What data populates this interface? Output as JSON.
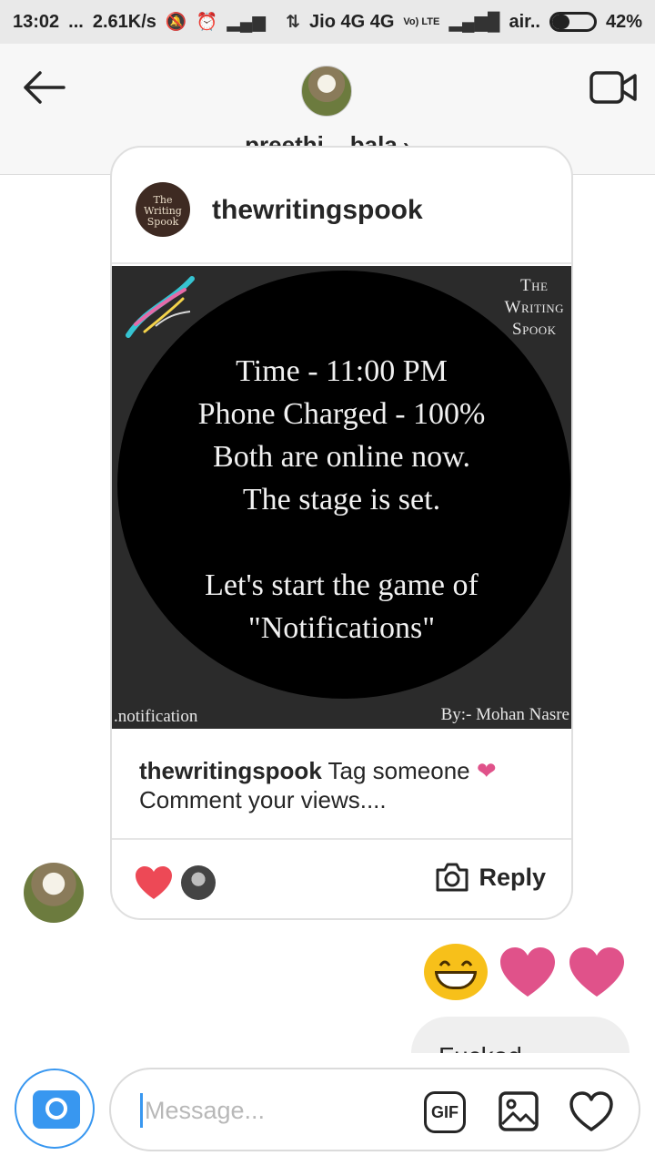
{
  "status_bar": {
    "time": "13:02",
    "dots": "...",
    "speed": "2.61K/s",
    "carrier1": "Jio 4G 4G",
    "volte": "Vo) LTE",
    "carrier2": "air..",
    "battery": "42%",
    "battery_level": 0.42
  },
  "header": {
    "username": "preethi__bala",
    "chevron": "›",
    "back_icon": "arrow-left-icon",
    "video_icon": "video-camera-icon"
  },
  "shared_post": {
    "source_account": "thewritingspook",
    "source_avatar_text": "The Writing Spook",
    "image": {
      "brand_lines": [
        "The",
        "Writing",
        "Spook"
      ],
      "lines": [
        "Time - 11:00 PM",
        "Phone Charged - 100%",
        "Both are online now.",
        "The stage is set.",
        "",
        "Let's start the game of",
        "\"Notifications\""
      ],
      "footer_left": ".notification",
      "footer_right": "By:- Mohan Nasre"
    },
    "caption_user": "thewritingspook",
    "caption_text_1": " Tag someone ",
    "caption_heart": "❤",
    "caption_text_2": "Comment your views....",
    "reply_label": "Reply",
    "reaction_icon": "heart-filled-icon"
  },
  "messages": {
    "emoji_reaction": [
      "grinning-face",
      "heart",
      "heart"
    ],
    "partial_bubble_text": "Fucked "
  },
  "composer": {
    "placeholder": "Message...",
    "gif_label": "GIF"
  },
  "colors": {
    "accent_blue": "#3897f0",
    "heart_red": "#ed4956",
    "heart_pink": "#e0528a"
  }
}
